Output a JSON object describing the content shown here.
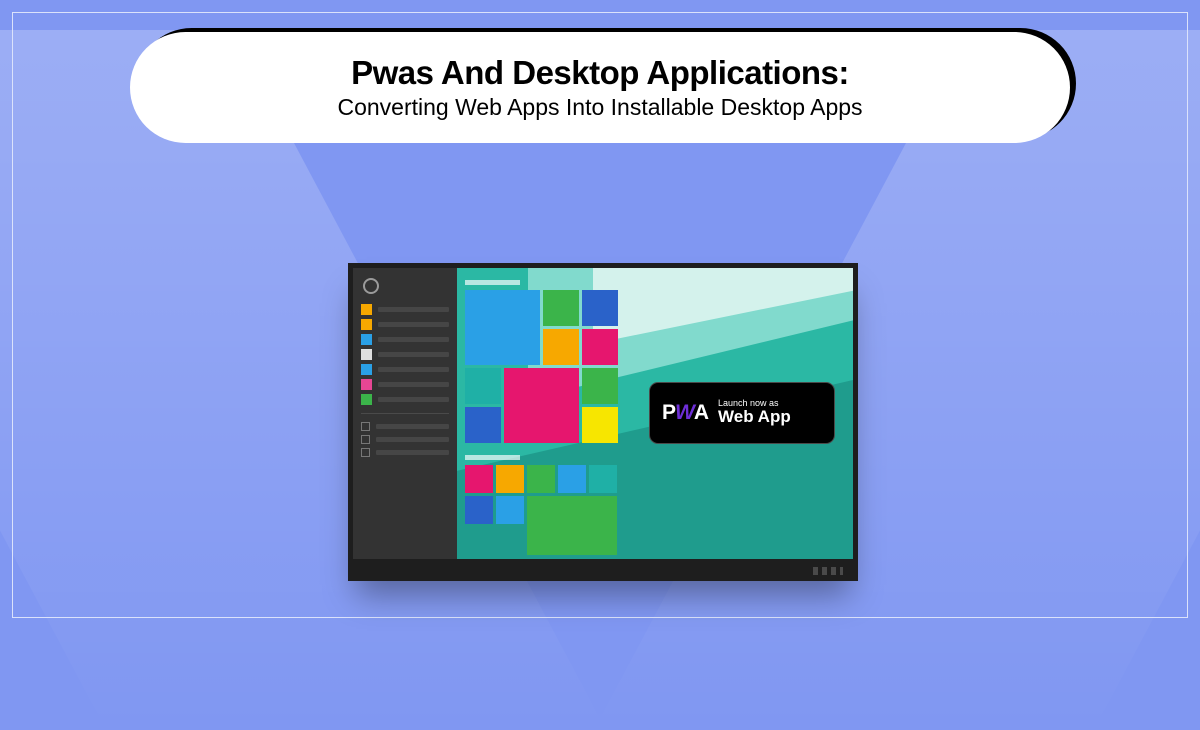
{
  "header": {
    "title": "Pwas And Desktop Applications:",
    "subtitle": "Converting Web Apps Into Installable Desktop Apps"
  },
  "sidebar": {
    "chip_colors": [
      "#f7a800",
      "#f7a800",
      "#2aa0e6",
      "#e0e0e0",
      "#2aa0e6",
      "#e74694",
      "#3bb44a"
    ],
    "check_count": 3
  },
  "tiles": {
    "group1": [
      {
        "c": "#2aa0e6",
        "w": 2,
        "h": 2
      },
      {
        "c": "#3bb44a",
        "w": 1,
        "h": 1
      },
      {
        "c": "#2a62c9",
        "w": 1,
        "h": 1
      },
      {
        "c": "#f7a800",
        "w": 1,
        "h": 1
      },
      {
        "c": "#e6166e",
        "w": 1,
        "h": 1
      },
      {
        "c": "#1fb0a6",
        "w": 1,
        "h": 1
      },
      {
        "c": "#e6166e",
        "w": 2,
        "h": 2
      },
      {
        "c": "#3bb44a",
        "w": 1,
        "h": 1
      },
      {
        "c": "#2a62c9",
        "w": 1,
        "h": 1
      },
      {
        "c": "#f7e600",
        "w": 1,
        "h": 1
      }
    ],
    "group2": [
      {
        "c": "#e6166e",
        "w": 1,
        "h": 1
      },
      {
        "c": "#f7a800",
        "w": 1,
        "h": 1
      },
      {
        "c": "#3bb44a",
        "w": 1,
        "h": 1
      },
      {
        "c": "#2aa0e6",
        "w": 1,
        "h": 1
      },
      {
        "c": "#1fb0a6",
        "w": 1,
        "h": 1
      },
      {
        "c": "#2a62c9",
        "w": 1,
        "h": 1
      },
      {
        "c": "#2aa0e6",
        "w": 1,
        "h": 1
      },
      {
        "c": "#3bb44a",
        "w": 3,
        "h": 2
      }
    ],
    "group3": [
      {
        "c": "#e64b1f"
      },
      {
        "c": "#f7a800"
      },
      {
        "c": "#3bb44a"
      },
      {
        "c": "#2aa0e6"
      },
      {
        "c": "#8a3bd6"
      }
    ]
  },
  "pwa_badge": {
    "logo_p": "P",
    "logo_w": "W",
    "logo_a": "A",
    "line1": "Launch now as",
    "line2": "Web App"
  }
}
